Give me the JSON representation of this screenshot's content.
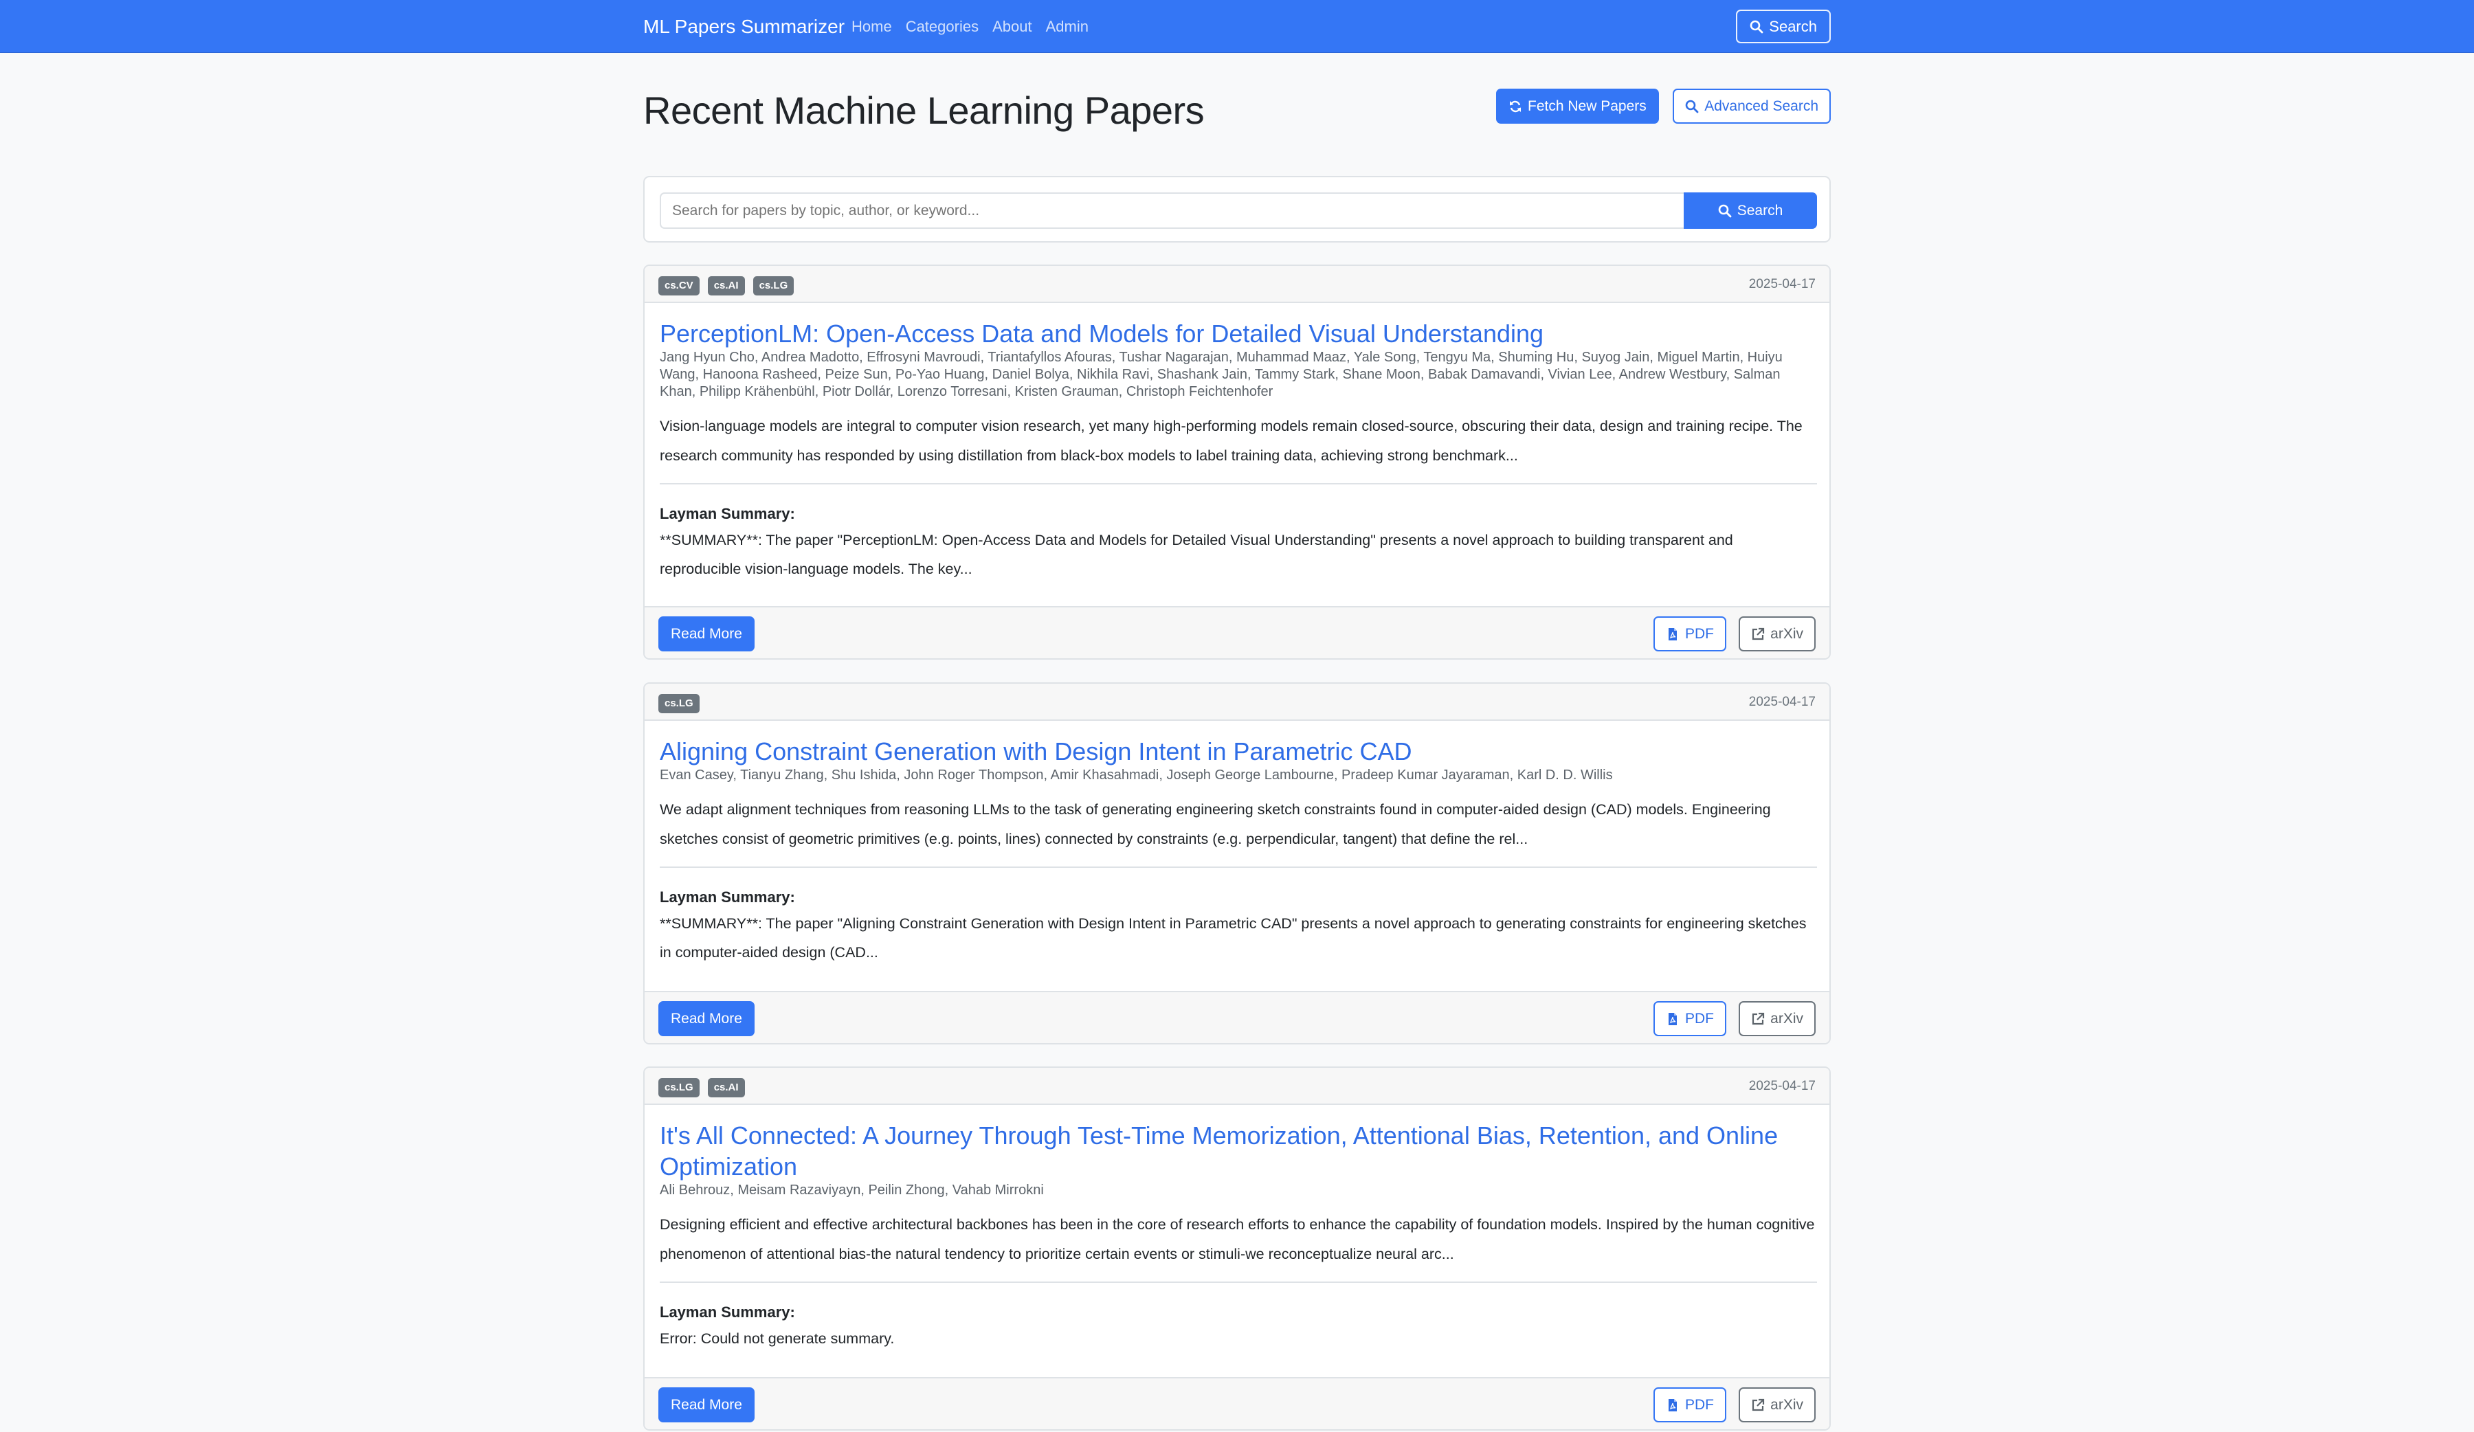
{
  "navbar": {
    "brand": "ML Papers Summarizer",
    "links": [
      "Home",
      "Categories",
      "About",
      "Admin"
    ],
    "search_label": "Search"
  },
  "header": {
    "title": "Recent Machine Learning Papers",
    "fetch_label": "Fetch New Papers",
    "advanced_label": "Advanced Search"
  },
  "search": {
    "placeholder": "Search for papers by topic, author, or keyword...",
    "button_label": "Search"
  },
  "papers": [
    {
      "tags": [
        "cs.CV",
        "cs.AI",
        "cs.LG"
      ],
      "date": "2025-04-17",
      "title": "PerceptionLM: Open-Access Data and Models for Detailed Visual Understanding",
      "authors": "Jang Hyun Cho, Andrea Madotto, Effrosyni Mavroudi, Triantafyllos Afouras, Tushar Nagarajan, Muhammad Maaz, Yale Song, Tengyu Ma, Shuming Hu, Suyog Jain, Miguel Martin, Huiyu Wang, Hanoona Rasheed, Peize Sun, Po-Yao Huang, Daniel Bolya, Nikhila Ravi, Shashank Jain, Tammy Stark, Shane Moon, Babak Damavandi, Vivian Lee, Andrew Westbury, Salman Khan, Philipp Krähenbühl, Piotr Dollár, Lorenzo Torresani, Kristen Grauman, Christoph Feichtenhofer",
      "abstract": "Vision-language models are integral to computer vision research, yet many high-performing models remain closed-source, obscuring their data, design and training recipe. The research community has responded by using distillation from black-box models to label training data, achieving strong benchmark...",
      "layman_label": "Layman Summary:",
      "layman": "**SUMMARY**: The paper \"PerceptionLM: Open-Access Data and Models for Detailed Visual Understanding\" presents a novel approach to building transparent and reproducible vision-language models. The key...",
      "read_more": "Read More",
      "pdf": "PDF",
      "arxiv": "arXiv"
    },
    {
      "tags": [
        "cs.LG"
      ],
      "date": "2025-04-17",
      "title": "Aligning Constraint Generation with Design Intent in Parametric CAD",
      "authors": "Evan Casey, Tianyu Zhang, Shu Ishida, John Roger Thompson, Amir Khasahmadi, Joseph George Lambourne, Pradeep Kumar Jayaraman, Karl D. D. Willis",
      "abstract": "We adapt alignment techniques from reasoning LLMs to the task of generating engineering sketch constraints found in computer-aided design (CAD) models. Engineering sketches consist of geometric primitives (e.g. points, lines) connected by constraints (e.g. perpendicular, tangent) that define the rel...",
      "layman_label": "Layman Summary:",
      "layman": "**SUMMARY**: The paper \"Aligning Constraint Generation with Design Intent in Parametric CAD\" presents a novel approach to generating constraints for engineering sketches in computer-aided design (CAD...",
      "read_more": "Read More",
      "pdf": "PDF",
      "arxiv": "arXiv"
    },
    {
      "tags": [
        "cs.LG",
        "cs.AI"
      ],
      "date": "2025-04-17",
      "title": "It's All Connected: A Journey Through Test-Time Memorization, Attentional Bias, Retention, and Online Optimization",
      "authors": "Ali Behrouz, Meisam Razaviyayn, Peilin Zhong, Vahab Mirrokni",
      "abstract": "Designing efficient and effective architectural backbones has been in the core of research efforts to enhance the capability of foundation models. Inspired by the human cognitive phenomenon of attentional bias-the natural tendency to prioritize certain events or stimuli-we reconceptualize neural arc...",
      "layman_label": "Layman Summary:",
      "layman": "Error: Could not generate summary.",
      "read_more": "Read More",
      "pdf": "PDF",
      "arxiv": "arXiv"
    }
  ]
}
